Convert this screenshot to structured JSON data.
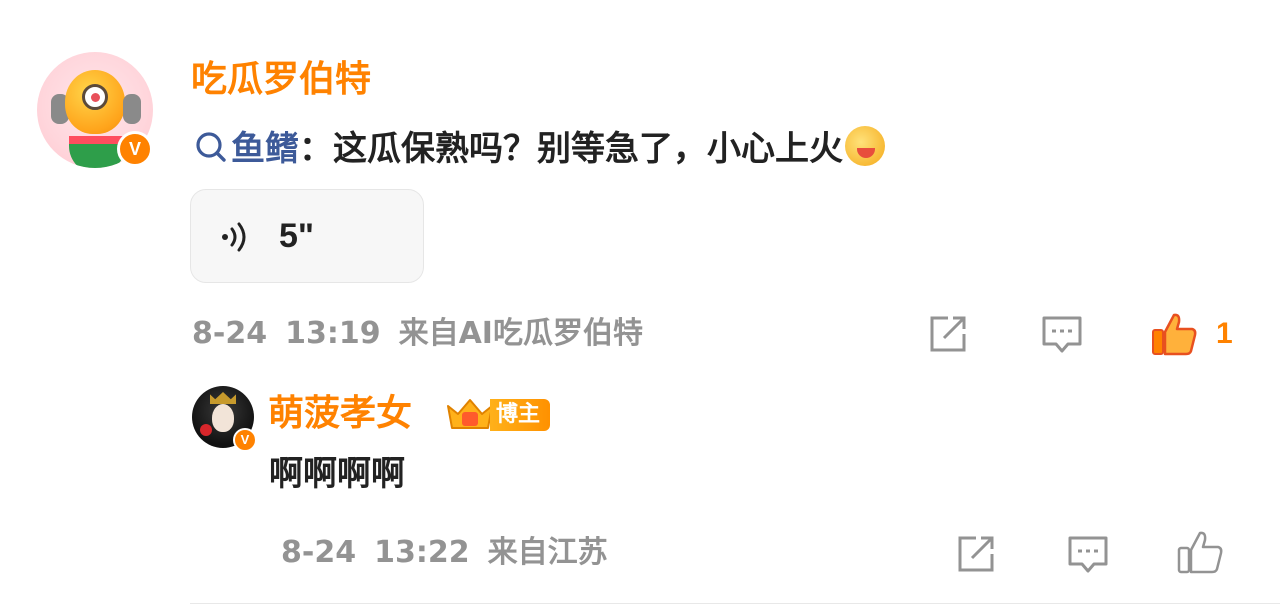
{
  "post": {
    "author": "吃瓜罗伯特",
    "verified_badge": "V",
    "mention": "鱼鳍",
    "text": "：这瓜保熟吗？别等急了，小心上火",
    "emoji": "melon-eating-emoji",
    "voice": {
      "duration": "5\""
    },
    "date": "8-24",
    "time": "13:19",
    "source": "来自AI吃瓜罗伯特",
    "like_count": "1",
    "liked": true
  },
  "reply": {
    "author": "萌菠孝女",
    "verified_badge": "V",
    "role_badge": "博主",
    "text": "啊啊啊啊",
    "date": "8-24",
    "time": "13:22",
    "source": "来自江苏",
    "liked": false
  },
  "colors": {
    "accent": "#ff8200",
    "mention": "#3d5a99",
    "meta": "#939393",
    "text": "#222222"
  }
}
